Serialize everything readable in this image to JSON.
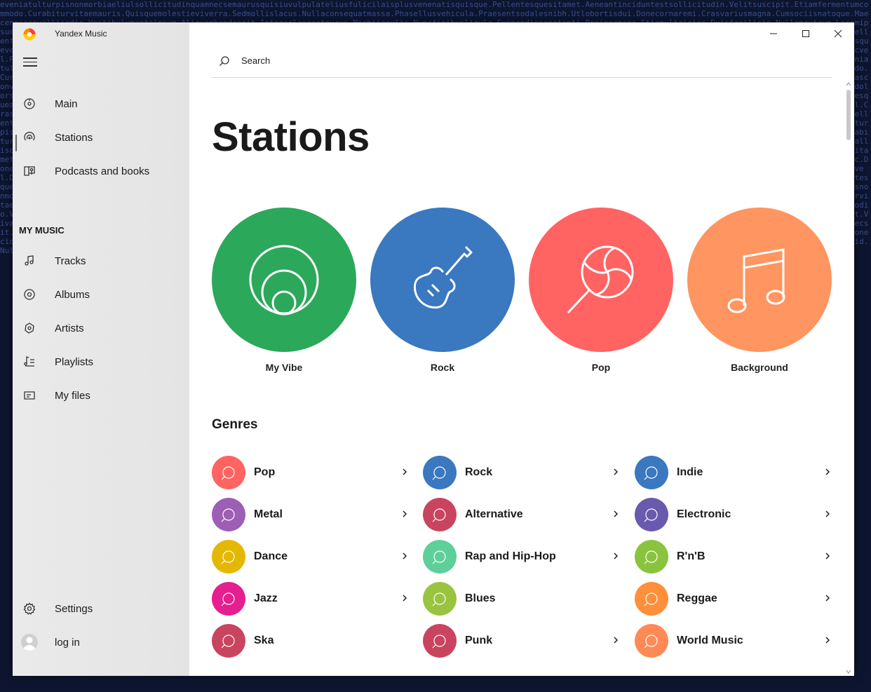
{
  "app": {
    "title": "Yandex Music"
  },
  "sidebar": {
    "nav": [
      {
        "label": "Main",
        "icon": "main-disc-icon"
      },
      {
        "label": "Stations",
        "icon": "stations-icon"
      },
      {
        "label": "Podcasts and books",
        "icon": "podcasts-book-icon"
      }
    ],
    "section_title": "MY MUSIC",
    "my_music": [
      {
        "label": "Tracks",
        "icon": "music-note-icon"
      },
      {
        "label": "Albums",
        "icon": "album-disc-icon"
      },
      {
        "label": "Artists",
        "icon": "artist-icon"
      },
      {
        "label": "Playlists",
        "icon": "playlist-icon"
      },
      {
        "label": "My files",
        "icon": "folder-icon"
      }
    ],
    "settings_label": "Settings",
    "login_label": "log in"
  },
  "search": {
    "placeholder": "Search"
  },
  "page": {
    "title": "Stations"
  },
  "stations": [
    {
      "label": "My Vibe",
      "color": "#2ca85a"
    },
    {
      "label": "Rock",
      "color": "#3a78c0"
    },
    {
      "label": "Pop",
      "color": "#ff6463"
    },
    {
      "label": "Background",
      "color": "#ff9560"
    }
  ],
  "genres": {
    "title": "Genres",
    "items": [
      {
        "label": "Pop",
        "color": "#ff6463",
        "chevron": true
      },
      {
        "label": "Rock",
        "color": "#3a78c0",
        "chevron": true
      },
      {
        "label": "Indie",
        "color": "#3a78c0",
        "chevron": true
      },
      {
        "label": "Metal",
        "color": "#9c5fb5",
        "chevron": true
      },
      {
        "label": "Alternative",
        "color": "#c9455f",
        "chevron": true
      },
      {
        "label": "Electronic",
        "color": "#6a5aad",
        "chevron": true
      },
      {
        "label": "Dance",
        "color": "#e5b800",
        "chevron": true
      },
      {
        "label": "Rap and Hip-Hop",
        "color": "#5fcf9a",
        "chevron": true
      },
      {
        "label": "R'n'B",
        "color": "#8ac43f",
        "chevron": true
      },
      {
        "label": "Jazz",
        "color": "#e51f8f",
        "chevron": true
      },
      {
        "label": "Blues",
        "color": "#9ac43f",
        "chevron": false
      },
      {
        "label": "Reggae",
        "color": "#ff8f3a",
        "chevron": true
      },
      {
        "label": "Ska",
        "color": "#c9455f",
        "chevron": false
      },
      {
        "label": "Punk",
        "color": "#c9455f",
        "chevron": true
      },
      {
        "label": "World Music",
        "color": "#ff8a55",
        "chevron": true
      }
    ]
  }
}
